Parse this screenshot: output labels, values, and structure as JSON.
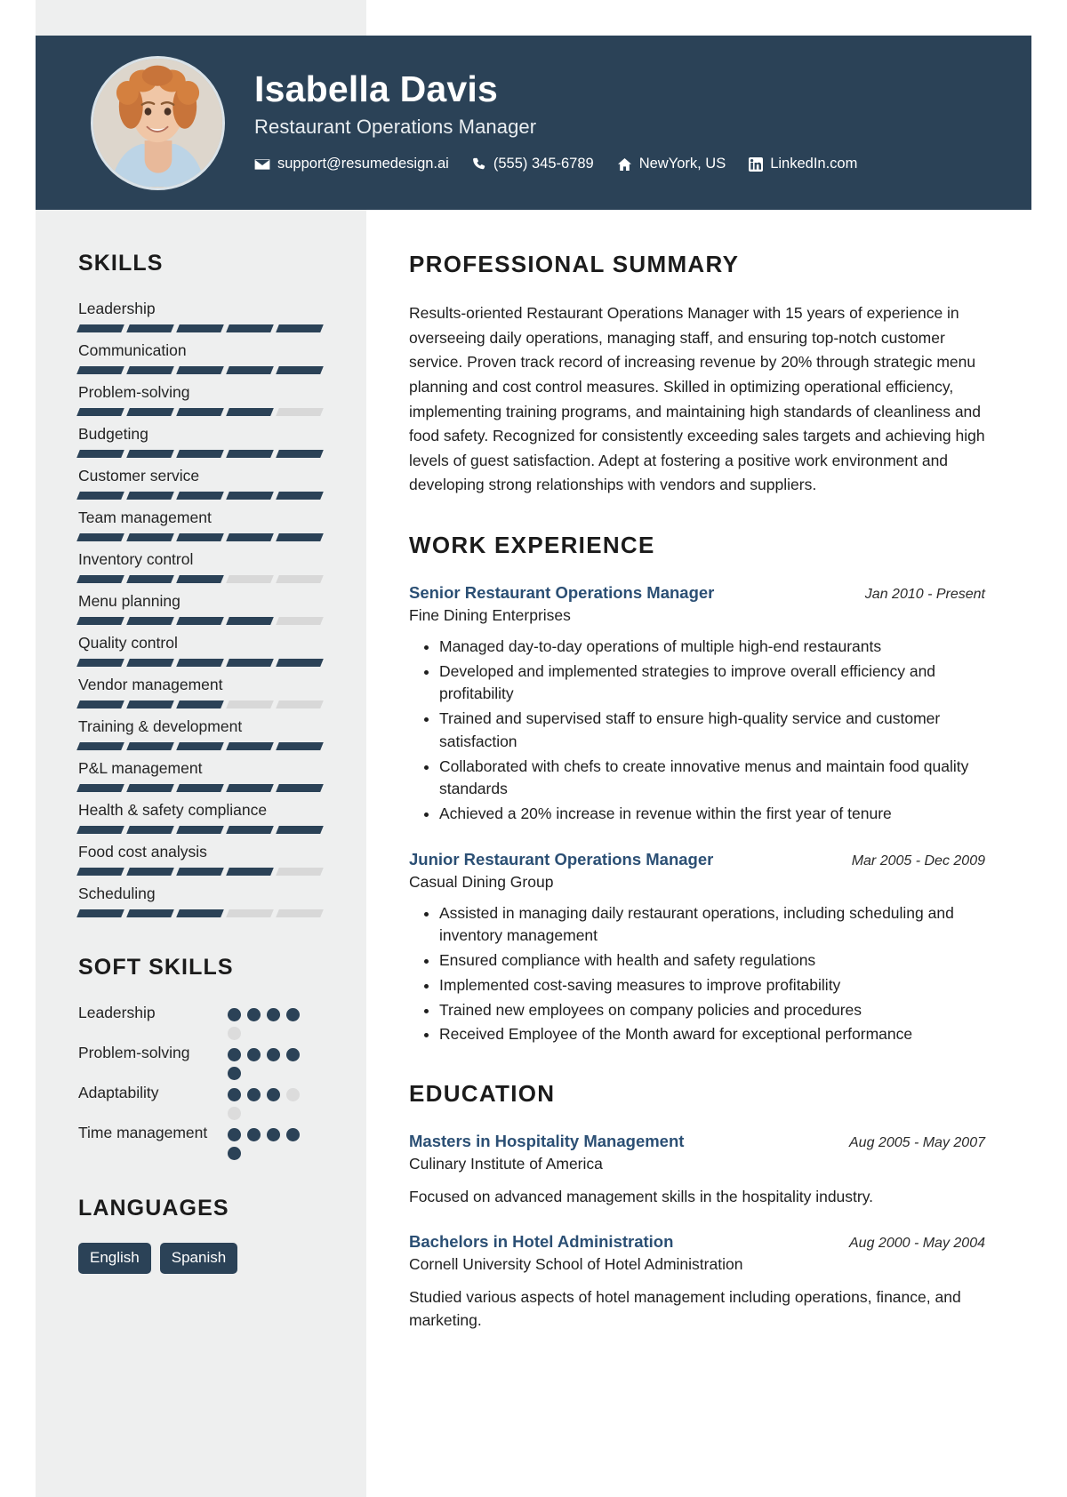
{
  "theme": {
    "header_bg": "#2b4257",
    "sidebar_bg": "#eeefef",
    "accent": "#2b4f74",
    "bar_on": "#2b4257",
    "bar_off": "#d8d8d8"
  },
  "header": {
    "name": "Isabella Davis",
    "job_title": "Restaurant Operations Manager",
    "contacts": [
      {
        "icon": "envelope-icon",
        "text": "support@resumedesign.ai"
      },
      {
        "icon": "phone-icon",
        "text": "(555) 345-6789"
      },
      {
        "icon": "home-icon",
        "text": "NewYork, US"
      },
      {
        "icon": "linkedin-icon",
        "text": "LinkedIn.com"
      }
    ]
  },
  "sidebar": {
    "skills_title": "SKILLS",
    "skills_max": 5,
    "skills": [
      {
        "name": "Leadership",
        "level": 5
      },
      {
        "name": "Communication",
        "level": 5
      },
      {
        "name": "Problem-solving",
        "level": 4
      },
      {
        "name": "Budgeting",
        "level": 5
      },
      {
        "name": "Customer service",
        "level": 5
      },
      {
        "name": "Team management",
        "level": 5
      },
      {
        "name": "Inventory control",
        "level": 3
      },
      {
        "name": "Menu planning",
        "level": 4
      },
      {
        "name": "Quality control",
        "level": 5
      },
      {
        "name": "Vendor management",
        "level": 3
      },
      {
        "name": "Training & development",
        "level": 5
      },
      {
        "name": "P&L management",
        "level": 5
      },
      {
        "name": "Health & safety compliance",
        "level": 5
      },
      {
        "name": "Food cost analysis",
        "level": 4
      },
      {
        "name": "Scheduling",
        "level": 3
      }
    ],
    "soft_title": "SOFT SKILLS",
    "soft_max": 5,
    "soft_skills": [
      {
        "name": "Leadership",
        "level": 4
      },
      {
        "name": "Problem-solving",
        "level": 5
      },
      {
        "name": "Adaptability",
        "level": 3
      },
      {
        "name": "Time management",
        "level": 5
      }
    ],
    "languages_title": "LANGUAGES",
    "languages": [
      "English",
      "Spanish"
    ]
  },
  "main": {
    "summary_title": "PROFESSIONAL SUMMARY",
    "summary_text": "Results-oriented Restaurant Operations Manager with 15 years of experience in overseeing daily operations, managing staff, and ensuring top-notch customer service. Proven track record of increasing revenue by 20% through strategic menu planning and cost control measures. Skilled in optimizing operational efficiency, implementing training programs, and maintaining high standards of cleanliness and food safety. Recognized for consistently exceeding sales targets and achieving high levels of guest satisfaction. Adept at fostering a positive work environment and developing strong relationships with vendors and suppliers.",
    "experience_title": "WORK EXPERIENCE",
    "experience": [
      {
        "title": "Senior Restaurant Operations Manager",
        "date": "Jan 2010 - Present",
        "org": "Fine Dining Enterprises",
        "bullets": [
          "Managed day-to-day operations of multiple high-end restaurants",
          "Developed and implemented strategies to improve overall efficiency and profitability",
          "Trained and supervised staff to ensure high-quality service and customer satisfaction",
          "Collaborated with chefs to create innovative menus and maintain food quality standards",
          "Achieved a 20% increase in revenue within the first year of tenure"
        ]
      },
      {
        "title": "Junior Restaurant Operations Manager",
        "date": "Mar 2005 - Dec 2009",
        "org": "Casual Dining Group",
        "bullets": [
          "Assisted in managing daily restaurant operations, including scheduling and inventory management",
          "Ensured compliance with health and safety regulations",
          "Implemented cost-saving measures to improve profitability",
          "Trained new employees on company policies and procedures",
          "Received Employee of the Month award for exceptional performance"
        ]
      }
    ],
    "education_title": "EDUCATION",
    "education": [
      {
        "title": "Masters in Hospitality Management",
        "date": "Aug 2005 - May 2007",
        "org": "Culinary Institute of America",
        "desc": "Focused on advanced management skills in the hospitality industry."
      },
      {
        "title": "Bachelors in Hotel Administration",
        "date": "Aug 2000 - May 2004",
        "org": "Cornell University School of Hotel Administration",
        "desc": "Studied various aspects of hotel management including operations, finance, and marketing."
      }
    ]
  }
}
